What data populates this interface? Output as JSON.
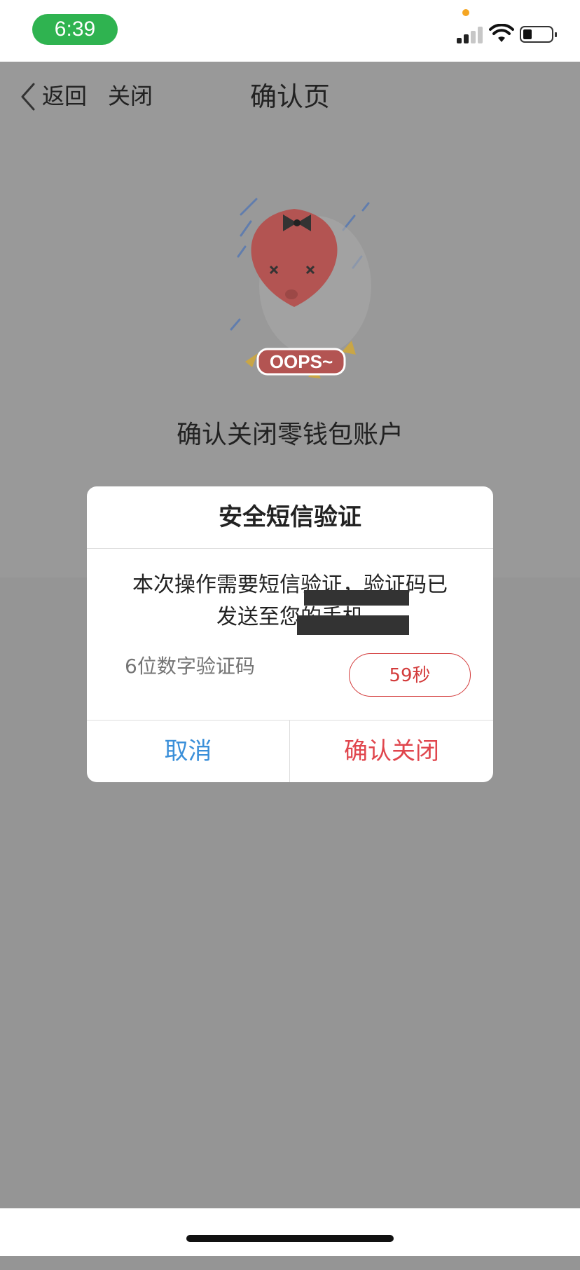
{
  "status_bar": {
    "time": "6:39",
    "colors": {
      "time_pill": "#2fb350",
      "privacy_dot": "#f5a623"
    },
    "icons": [
      "signal-icon",
      "wifi-icon",
      "battery-icon"
    ]
  },
  "nav": {
    "back_label": "返回",
    "close_label": "关闭",
    "title": "确认页"
  },
  "illustration": {
    "badge_text": "OOPS~",
    "balloon_color": "#c75a57"
  },
  "headline": "确认关闭零钱包账户",
  "dialog": {
    "title": "安全短信验证",
    "message_line1": "本次操作需要短信验证，验证码已",
    "message_line2": "发送至您的手机",
    "code_placeholder": "6位数字验证码",
    "countdown": "59秒",
    "cancel_label": "取消",
    "confirm_label": "确认关闭",
    "colors": {
      "cancel": "#3a8fd9",
      "confirm": "#e0464d",
      "countdown": "#d33b3b"
    }
  }
}
